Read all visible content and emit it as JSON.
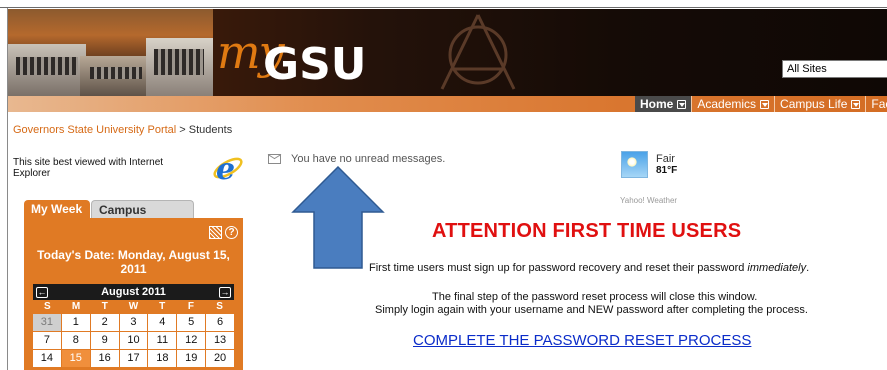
{
  "banner": {
    "logo_prefix": "my",
    "logo_text": "GSU",
    "site_search_scope": "All Sites"
  },
  "nav": {
    "items": [
      {
        "label": "Home",
        "active": true
      },
      {
        "label": "Academics",
        "active": false
      },
      {
        "label": "Campus Life",
        "active": false
      },
      {
        "label": "Facu",
        "active": false
      }
    ]
  },
  "breadcrumb": {
    "link_text": "Governors State University Portal",
    "separator": " > ",
    "current": "Students"
  },
  "ie_note": {
    "text": "This site best viewed with Internet Explorer",
    "icon": "internet-explorer-icon"
  },
  "messages": {
    "text": "You have no unread messages.",
    "icon": "mail-icon"
  },
  "weather": {
    "condition": "Fair",
    "temperature": "81°F",
    "source": "Yahoo! Weather",
    "icon": "sunny-weather-icon"
  },
  "widget": {
    "tabs": [
      {
        "label": "My Week",
        "active": true
      },
      {
        "label": "Campus Events",
        "active": false
      }
    ],
    "today_label": "Today's Date:  Monday, August 15, 2011",
    "calendar": {
      "month_label": "August 2011",
      "prev_symbol": "←",
      "next_symbol": "→",
      "weekdays": [
        "S",
        "M",
        "T",
        "W",
        "T",
        "F",
        "S"
      ],
      "days": [
        {
          "d": "31",
          "other": true
        },
        {
          "d": "1"
        },
        {
          "d": "2"
        },
        {
          "d": "3"
        },
        {
          "d": "4"
        },
        {
          "d": "5"
        },
        {
          "d": "6"
        },
        {
          "d": "7"
        },
        {
          "d": "8"
        },
        {
          "d": "9"
        },
        {
          "d": "10"
        },
        {
          "d": "11"
        },
        {
          "d": "12"
        },
        {
          "d": "13"
        },
        {
          "d": "14"
        },
        {
          "d": "15",
          "today": true
        },
        {
          "d": "16"
        },
        {
          "d": "17"
        },
        {
          "d": "18"
        },
        {
          "d": "19"
        },
        {
          "d": "20"
        }
      ]
    }
  },
  "main": {
    "heading": "ATTENTION FIRST TIME USERS",
    "line1_before": "First time users must sign up for password recovery and reset their password ",
    "line1_emphasis": "immediately",
    "line1_after": ".",
    "line2": "The final step of the password reset process will close this window.",
    "line3": "Simply login again with your username and NEW password after completing the process.",
    "reset_link": "COMPLETE THE PASSWORD RESET PROCESS"
  },
  "colors": {
    "accent_orange": "#e07a24",
    "heading_red": "#e01010",
    "link_blue": "#0b2cc9",
    "arrow_blue": "#4a7dbf"
  }
}
